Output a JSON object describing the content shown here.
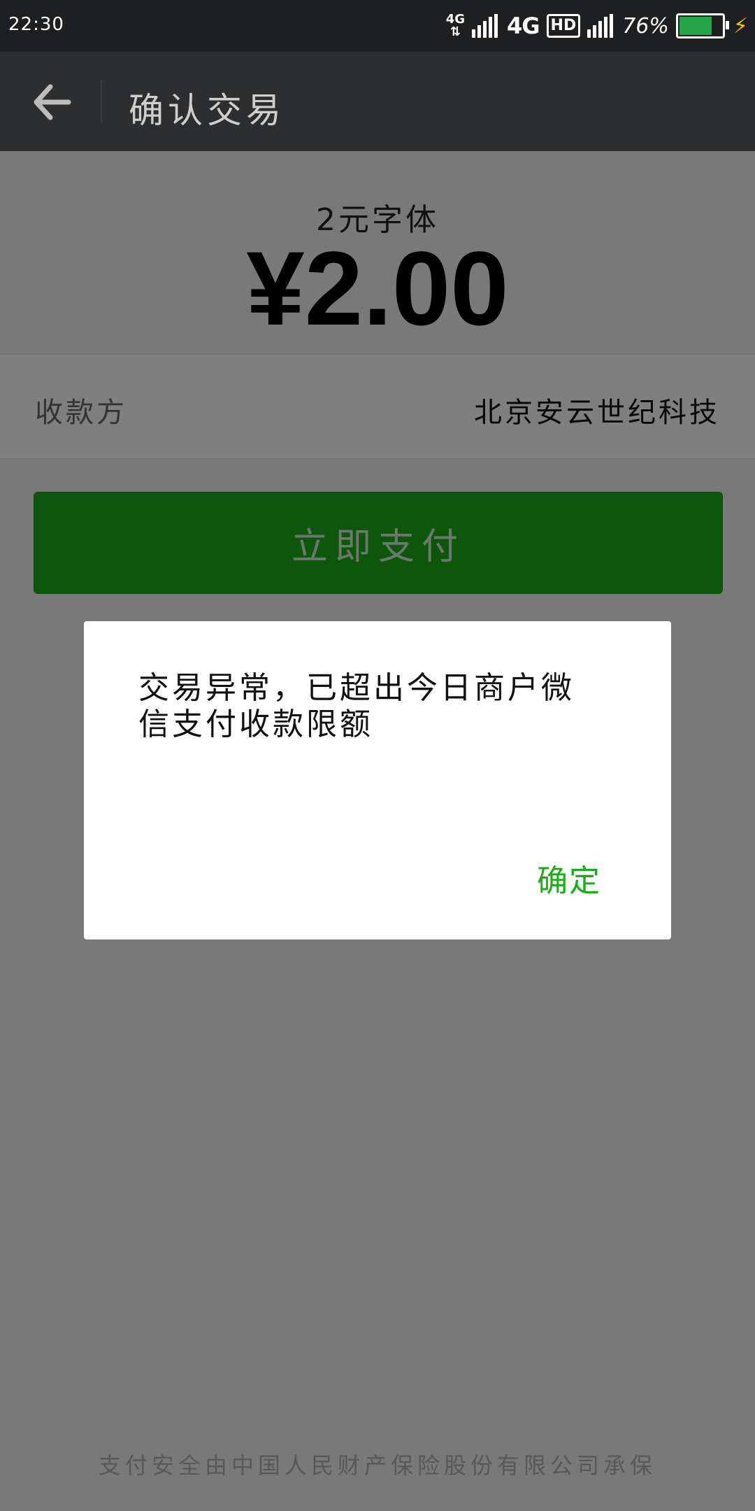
{
  "status_bar": {
    "time": "22:30",
    "network_small": "4G",
    "network_arrows": "⇅",
    "network_big": "4G",
    "hd": "HD",
    "battery_percent": "76%",
    "battery_level": 0.76,
    "battery_color": "#22a447"
  },
  "header": {
    "title": "确认交易",
    "back_icon": "arrow-left-icon"
  },
  "payment": {
    "product_name": "2元字体",
    "amount": "¥2.00",
    "payee_label": "收款方",
    "payee_value": "北京安云世纪科技",
    "pay_button_label": "立即支付",
    "footer_note": "支付安全由中国人民财产保险股份有限公司承保"
  },
  "dialog": {
    "message": "交易异常，已超出今日商户微信支付收款限额",
    "confirm_label": "确定"
  },
  "colors": {
    "accent_green": "#1aad19",
    "header_bg": "#2d2e30",
    "status_bg": "#1e1f21"
  }
}
